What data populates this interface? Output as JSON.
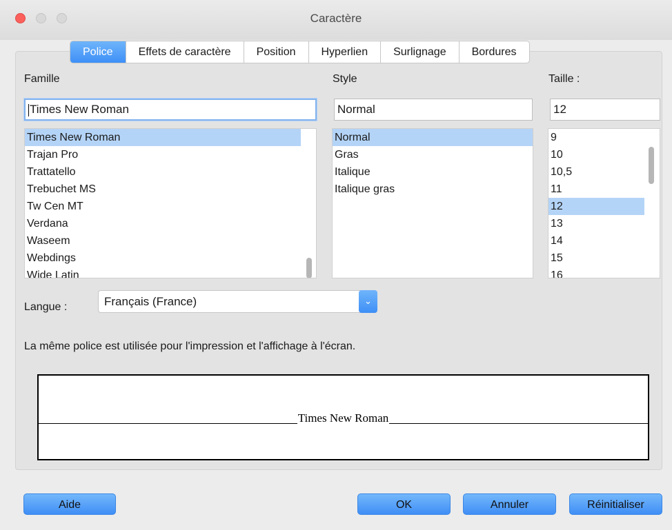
{
  "window": {
    "title": "Caractère"
  },
  "tabs": [
    "Police",
    "Effets de caractère",
    "Position",
    "Hyperlien",
    "Surlignage",
    "Bordures"
  ],
  "family": {
    "label": "Famille",
    "value": "Times New Roman",
    "items": [
      "Times New Roman",
      "Trajan Pro",
      "Trattatello",
      "Trebuchet MS",
      "Tw Cen MT",
      "Verdana",
      "Waseem",
      "Webdings",
      "Wide Latin"
    ]
  },
  "style": {
    "label": "Style",
    "value": "Normal",
    "items": [
      "Normal",
      "Gras",
      "Italique",
      "Italique gras"
    ]
  },
  "size": {
    "label": "Taille :",
    "value": "12",
    "items": [
      "9",
      "10",
      "10,5",
      "11",
      "12",
      "13",
      "14",
      "15",
      "16"
    ]
  },
  "language": {
    "label": "Langue :",
    "value": "Français (France)"
  },
  "info": "La même police est utilisée pour l'impression et l'affichage à l'écran.",
  "preview": {
    "text": "Times New Roman"
  },
  "buttons": {
    "help": "Aide",
    "ok": "OK",
    "cancel": "Annuler",
    "reset": "Réinitialiser"
  }
}
